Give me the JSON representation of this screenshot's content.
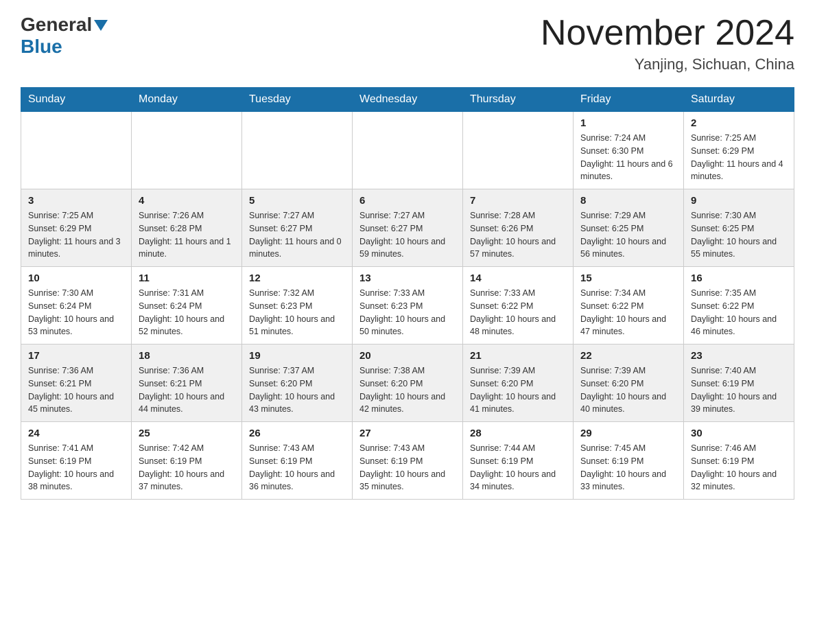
{
  "header": {
    "logo_line1": "General",
    "logo_line2": "Blue",
    "main_title": "November 2024",
    "subtitle": "Yanjing, Sichuan, China"
  },
  "days_of_week": [
    "Sunday",
    "Monday",
    "Tuesday",
    "Wednesday",
    "Thursday",
    "Friday",
    "Saturday"
  ],
  "weeks": [
    {
      "days": [
        {
          "number": "",
          "info": ""
        },
        {
          "number": "",
          "info": ""
        },
        {
          "number": "",
          "info": ""
        },
        {
          "number": "",
          "info": ""
        },
        {
          "number": "",
          "info": ""
        },
        {
          "number": "1",
          "info": "Sunrise: 7:24 AM\nSunset: 6:30 PM\nDaylight: 11 hours and 6 minutes."
        },
        {
          "number": "2",
          "info": "Sunrise: 7:25 AM\nSunset: 6:29 PM\nDaylight: 11 hours and 4 minutes."
        }
      ]
    },
    {
      "days": [
        {
          "number": "3",
          "info": "Sunrise: 7:25 AM\nSunset: 6:29 PM\nDaylight: 11 hours and 3 minutes."
        },
        {
          "number": "4",
          "info": "Sunrise: 7:26 AM\nSunset: 6:28 PM\nDaylight: 11 hours and 1 minute."
        },
        {
          "number": "5",
          "info": "Sunrise: 7:27 AM\nSunset: 6:27 PM\nDaylight: 11 hours and 0 minutes."
        },
        {
          "number": "6",
          "info": "Sunrise: 7:27 AM\nSunset: 6:27 PM\nDaylight: 10 hours and 59 minutes."
        },
        {
          "number": "7",
          "info": "Sunrise: 7:28 AM\nSunset: 6:26 PM\nDaylight: 10 hours and 57 minutes."
        },
        {
          "number": "8",
          "info": "Sunrise: 7:29 AM\nSunset: 6:25 PM\nDaylight: 10 hours and 56 minutes."
        },
        {
          "number": "9",
          "info": "Sunrise: 7:30 AM\nSunset: 6:25 PM\nDaylight: 10 hours and 55 minutes."
        }
      ]
    },
    {
      "days": [
        {
          "number": "10",
          "info": "Sunrise: 7:30 AM\nSunset: 6:24 PM\nDaylight: 10 hours and 53 minutes."
        },
        {
          "number": "11",
          "info": "Sunrise: 7:31 AM\nSunset: 6:24 PM\nDaylight: 10 hours and 52 minutes."
        },
        {
          "number": "12",
          "info": "Sunrise: 7:32 AM\nSunset: 6:23 PM\nDaylight: 10 hours and 51 minutes."
        },
        {
          "number": "13",
          "info": "Sunrise: 7:33 AM\nSunset: 6:23 PM\nDaylight: 10 hours and 50 minutes."
        },
        {
          "number": "14",
          "info": "Sunrise: 7:33 AM\nSunset: 6:22 PM\nDaylight: 10 hours and 48 minutes."
        },
        {
          "number": "15",
          "info": "Sunrise: 7:34 AM\nSunset: 6:22 PM\nDaylight: 10 hours and 47 minutes."
        },
        {
          "number": "16",
          "info": "Sunrise: 7:35 AM\nSunset: 6:22 PM\nDaylight: 10 hours and 46 minutes."
        }
      ]
    },
    {
      "days": [
        {
          "number": "17",
          "info": "Sunrise: 7:36 AM\nSunset: 6:21 PM\nDaylight: 10 hours and 45 minutes."
        },
        {
          "number": "18",
          "info": "Sunrise: 7:36 AM\nSunset: 6:21 PM\nDaylight: 10 hours and 44 minutes."
        },
        {
          "number": "19",
          "info": "Sunrise: 7:37 AM\nSunset: 6:20 PM\nDaylight: 10 hours and 43 minutes."
        },
        {
          "number": "20",
          "info": "Sunrise: 7:38 AM\nSunset: 6:20 PM\nDaylight: 10 hours and 42 minutes."
        },
        {
          "number": "21",
          "info": "Sunrise: 7:39 AM\nSunset: 6:20 PM\nDaylight: 10 hours and 41 minutes."
        },
        {
          "number": "22",
          "info": "Sunrise: 7:39 AM\nSunset: 6:20 PM\nDaylight: 10 hours and 40 minutes."
        },
        {
          "number": "23",
          "info": "Sunrise: 7:40 AM\nSunset: 6:19 PM\nDaylight: 10 hours and 39 minutes."
        }
      ]
    },
    {
      "days": [
        {
          "number": "24",
          "info": "Sunrise: 7:41 AM\nSunset: 6:19 PM\nDaylight: 10 hours and 38 minutes."
        },
        {
          "number": "25",
          "info": "Sunrise: 7:42 AM\nSunset: 6:19 PM\nDaylight: 10 hours and 37 minutes."
        },
        {
          "number": "26",
          "info": "Sunrise: 7:43 AM\nSunset: 6:19 PM\nDaylight: 10 hours and 36 minutes."
        },
        {
          "number": "27",
          "info": "Sunrise: 7:43 AM\nSunset: 6:19 PM\nDaylight: 10 hours and 35 minutes."
        },
        {
          "number": "28",
          "info": "Sunrise: 7:44 AM\nSunset: 6:19 PM\nDaylight: 10 hours and 34 minutes."
        },
        {
          "number": "29",
          "info": "Sunrise: 7:45 AM\nSunset: 6:19 PM\nDaylight: 10 hours and 33 minutes."
        },
        {
          "number": "30",
          "info": "Sunrise: 7:46 AM\nSunset: 6:19 PM\nDaylight: 10 hours and 32 minutes."
        }
      ]
    }
  ]
}
